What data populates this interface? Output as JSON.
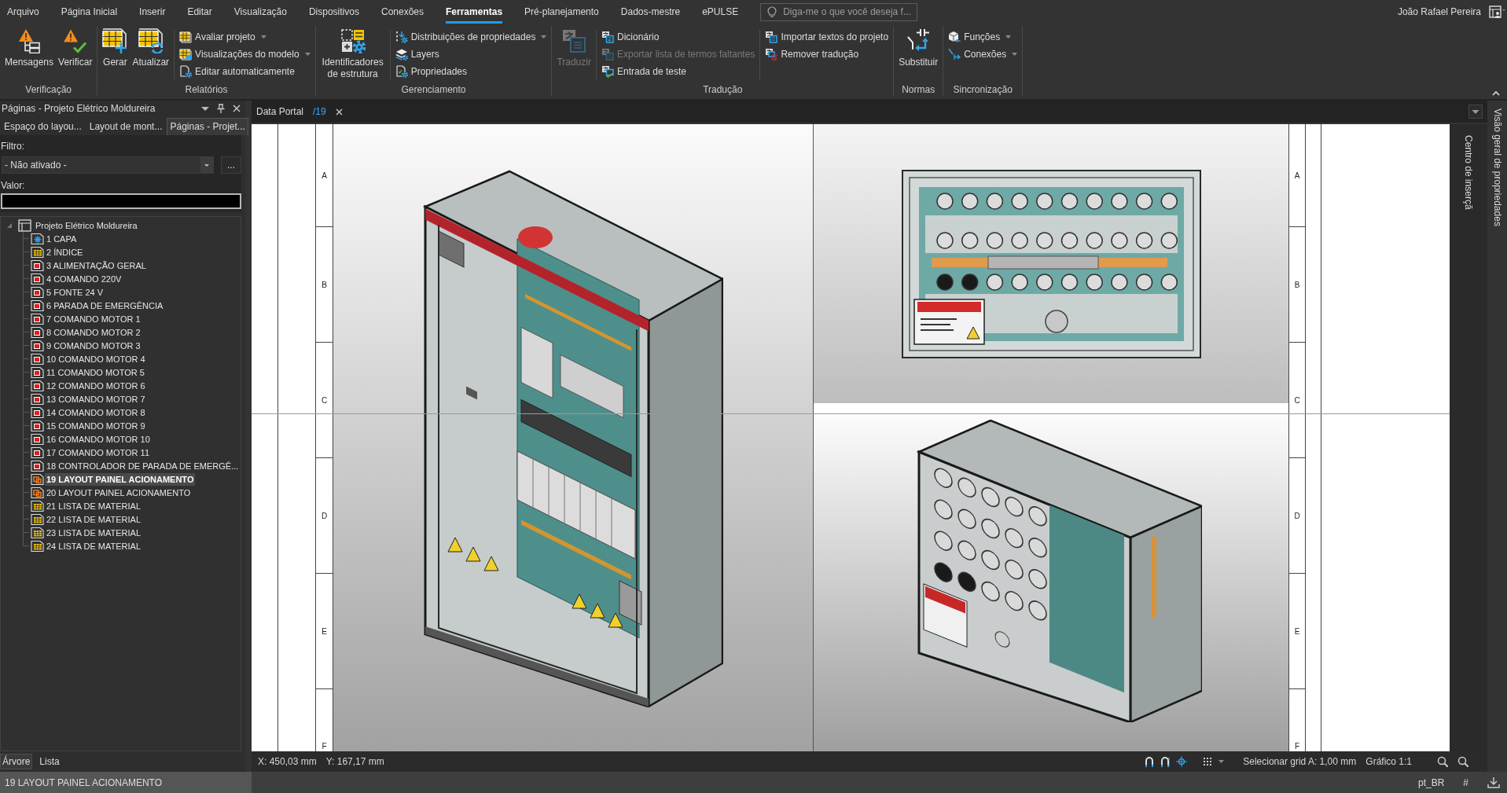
{
  "window": {
    "user_name": "João Rafael Pereira"
  },
  "menu_tabs": [
    {
      "label": "Arquivo",
      "selected": false
    },
    {
      "label": "Página Inicial",
      "selected": false
    },
    {
      "label": "Inserir",
      "selected": false
    },
    {
      "label": "Editar",
      "selected": false
    },
    {
      "label": "Visualização",
      "selected": false
    },
    {
      "label": "Dispositivos",
      "selected": false
    },
    {
      "label": "Conexões",
      "selected": false
    },
    {
      "label": "Ferramentas",
      "selected": true
    },
    {
      "label": "Pré-planejamento",
      "selected": false
    },
    {
      "label": "Dados-mestre",
      "selected": false
    },
    {
      "label": "ePULSE",
      "selected": false
    }
  ],
  "search": {
    "placeholder": "Diga-me o que você deseja f..."
  },
  "ribbon": {
    "groups": [
      {
        "label": "Verificação",
        "items": [
          {
            "kind": "large",
            "label": "Mensagens",
            "disabled": false,
            "dropdown": false
          },
          {
            "kind": "large",
            "label": "Verificar",
            "disabled": false,
            "dropdown": false
          }
        ]
      },
      {
        "label": "Relatórios",
        "items": [
          {
            "kind": "large",
            "label": "Gerar",
            "disabled": false,
            "dropdown": false
          },
          {
            "kind": "large",
            "label": "Atualizar",
            "disabled": false,
            "dropdown": false
          },
          {
            "kind": "small",
            "label": "Avaliar projeto",
            "disabled": false,
            "dropdown": true
          },
          {
            "kind": "small",
            "label": "Visualizações do modelo",
            "disabled": false,
            "dropdown": true
          },
          {
            "kind": "small",
            "label": "Editar automaticamente",
            "disabled": false,
            "dropdown": false
          }
        ]
      },
      {
        "label": "Gerenciamento",
        "items": [
          {
            "kind": "large",
            "label": "Identificadores de estrutura",
            "disabled": false,
            "dropdown": false
          },
          {
            "kind": "small",
            "label": "Distribuições de propriedades",
            "disabled": false,
            "dropdown": true
          },
          {
            "kind": "small",
            "label": "Layers",
            "disabled": false,
            "dropdown": false
          },
          {
            "kind": "small",
            "label": "Propriedades",
            "disabled": false,
            "dropdown": false
          }
        ]
      },
      {
        "label": "Tradução",
        "items": [
          {
            "kind": "large",
            "label": "Traduzir",
            "disabled": true,
            "dropdown": false
          },
          {
            "kind": "small",
            "label": "Dicionário",
            "disabled": false,
            "dropdown": false
          },
          {
            "kind": "small",
            "label": "Exportar lista de termos faltantes",
            "disabled": true,
            "dropdown": false
          },
          {
            "kind": "small",
            "label": "Entrada de teste",
            "disabled": false,
            "dropdown": false
          },
          {
            "kind": "small",
            "label": "Importar textos do projeto",
            "disabled": false,
            "dropdown": false
          },
          {
            "kind": "small",
            "label": "Remover tradução",
            "disabled": false,
            "dropdown": false
          }
        ]
      },
      {
        "label": "Normas",
        "items": [
          {
            "kind": "large",
            "label": "Substituir",
            "disabled": false,
            "dropdown": false
          }
        ]
      },
      {
        "label": "Sincronização",
        "items": [
          {
            "kind": "small",
            "label": "Funções",
            "disabled": false,
            "dropdown": true
          },
          {
            "kind": "small",
            "label": "Conexões",
            "disabled": false,
            "dropdown": true
          }
        ]
      }
    ]
  },
  "panel": {
    "title": "Páginas - Projeto Elétrico Moldureira",
    "tabs": [
      {
        "label": "Espaço do layou...",
        "selected": false
      },
      {
        "label": "Layout de mont...",
        "selected": false
      },
      {
        "label": "Páginas - Projet...",
        "selected": true
      }
    ],
    "filter": {
      "label": "Filtro:",
      "value": "- Não ativado -",
      "more": "..."
    },
    "value_field": {
      "label": "Valor:"
    },
    "tree": {
      "label": "Projeto Elétrico Moldureira",
      "expanded": true,
      "children": [
        {
          "label": "1 CAPA",
          "kind": "cover",
          "selected": false
        },
        {
          "label": "2 ÍNDICE",
          "kind": "table",
          "selected": false
        },
        {
          "label": "3 ALIMENTAÇÃO GERAL",
          "kind": "schematic",
          "selected": false
        },
        {
          "label": "4 COMANDO 220V",
          "kind": "schematic",
          "selected": false
        },
        {
          "label": "5 FONTE 24 V",
          "kind": "schematic",
          "selected": false
        },
        {
          "label": "6 PARADA DE EMERGÊNCIA",
          "kind": "schematic",
          "selected": false
        },
        {
          "label": "7 COMANDO MOTOR 1",
          "kind": "schematic",
          "selected": false
        },
        {
          "label": "8 COMANDO MOTOR 2",
          "kind": "schematic",
          "selected": false
        },
        {
          "label": "9 COMANDO MOTOR 3",
          "kind": "schematic",
          "selected": false
        },
        {
          "label": "10 COMANDO MOTOR 4",
          "kind": "schematic",
          "selected": false
        },
        {
          "label": "11 COMANDO MOTOR 5",
          "kind": "schematic",
          "selected": false
        },
        {
          "label": "12 COMANDO MOTOR 6",
          "kind": "schematic",
          "selected": false
        },
        {
          "label": "13 COMANDO MOTOR 7",
          "kind": "schematic",
          "selected": false
        },
        {
          "label": "14 COMANDO MOTOR 8",
          "kind": "schematic",
          "selected": false
        },
        {
          "label": "15 COMANDO MOTOR 9",
          "kind": "schematic",
          "selected": false
        },
        {
          "label": "16 COMANDO MOTOR 10",
          "kind": "schematic",
          "selected": false
        },
        {
          "label": "17 COMANDO MOTOR 11",
          "kind": "schematic",
          "selected": false
        },
        {
          "label": "18 CONTROLADOR DE PARADA DE EMERGÊ...",
          "kind": "schematic",
          "selected": false
        },
        {
          "label": "19 LAYOUT PAINEL ACIONAMENTO",
          "kind": "layout",
          "selected": true
        },
        {
          "label": "20 LAYOUT PAINEL ACIONAMENTO",
          "kind": "layout",
          "selected": false
        },
        {
          "label": "21 LISTA DE MATERIAL",
          "kind": "table",
          "selected": false
        },
        {
          "label": "22 LISTA DE MATERIAL",
          "kind": "table",
          "selected": false
        },
        {
          "label": "23 LISTA DE MATERIAL",
          "kind": "table",
          "selected": false
        },
        {
          "label": "24 LISTA DE MATERIAL",
          "kind": "table",
          "selected": false
        }
      ]
    },
    "view_tabs": [
      {
        "label": "Árvore",
        "selected": true
      },
      {
        "label": "Lista",
        "selected": false
      }
    ]
  },
  "doc_tabs": [
    {
      "label": "Data Portal",
      "selected": false
    },
    {
      "label": "/19",
      "selected": true
    }
  ],
  "sheet": {
    "rows_left": [
      "A",
      "B",
      "C",
      "D",
      "E",
      "F"
    ],
    "rows_right": [
      "A",
      "B",
      "C",
      "D",
      "E",
      "F"
    ]
  },
  "side_tabs": {
    "inner": "Centro de inserçã",
    "outer": "Visão geral de propriedades"
  },
  "status_bar": {
    "x": "X: 450,03 mm",
    "y": "Y: 167,17 mm",
    "grid": "Selecionar grid A: 1,00 mm",
    "scale": "Gráfico 1:1"
  },
  "bottom_bar": {
    "page": "19 LAYOUT PAINEL ACIONAMENTO",
    "language": "pt_BR",
    "mark": "#"
  }
}
